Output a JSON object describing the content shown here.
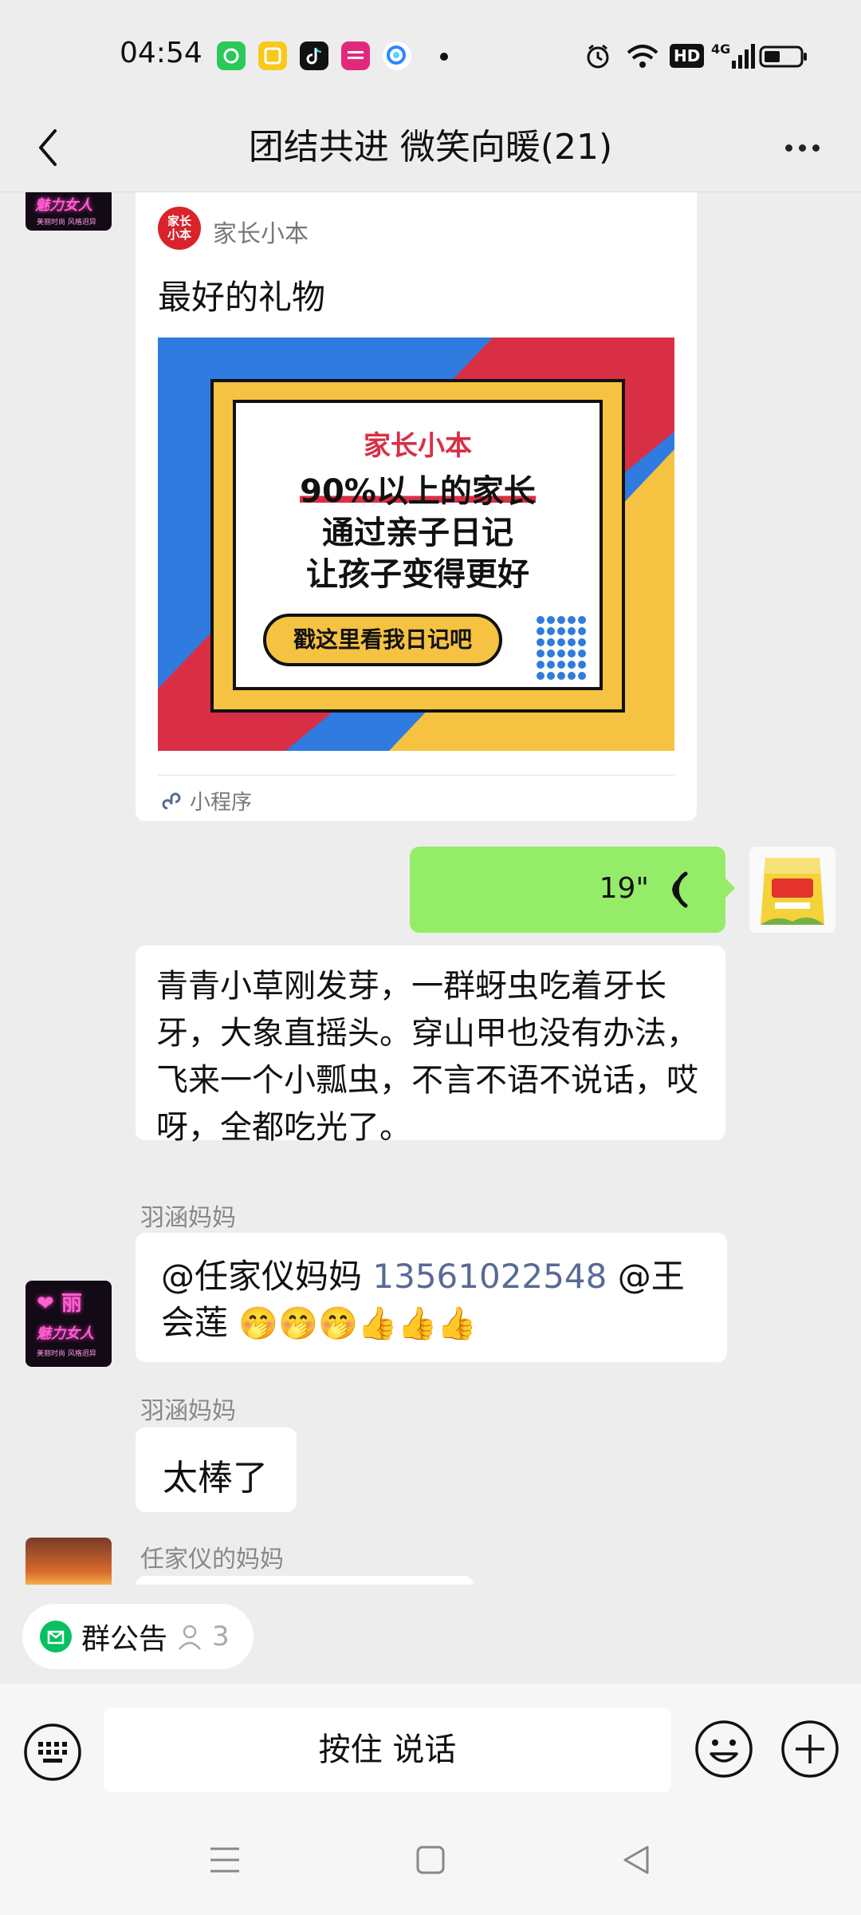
{
  "status_bar": {
    "time": "04:54",
    "icons_left": [
      "wechat-mini-icon",
      "yellow-app-icon",
      "tiktok-icon",
      "pink-app-icon",
      "browser-icon",
      "dot-icon"
    ],
    "icons_right": [
      "alarm-icon",
      "wifi-icon",
      "hd-icon",
      "4g-signal-icon",
      "battery-icon"
    ],
    "hd_label": "HD",
    "network_label": "4G",
    "battery_level": 0.45
  },
  "header": {
    "title": "团结共进  微笑向暖(21)"
  },
  "messages": {
    "card": {
      "source": "家长小本",
      "logo_text": "家长小本",
      "title": "最好的礼物",
      "banner": {
        "brand": "家长小本",
        "line1": "90%以上的家长",
        "line2": "通过亲子日记",
        "line3": "让孩子变得更好",
        "button": "戳这里看我日记吧"
      },
      "footer": "小程序"
    },
    "voice": {
      "duration": "19\""
    },
    "text_msg": "青青小草刚发芽，一群蚜虫吃着牙长牙，大象直摇头。穿山甲也没有办法，飞来一个小瓢虫，不言不语不说话，哎呀，全都吃光了。",
    "msg3": {
      "sender": "羽涵妈妈",
      "mention1": "@任家仪妈妈",
      "phone": "13561022548",
      "mention2": "@王会莲",
      "emoji": "🤭🤭🤭👍👍👍"
    },
    "msg4": {
      "sender": "羽涵妈妈",
      "text": "太棒了"
    },
    "msg5": {
      "sender": "任家仪的妈妈"
    },
    "avatar_text": {
      "top": "❤ 丽",
      "script": "魅力女人",
      "small": "美丽时尚 风格迥异"
    }
  },
  "notice": {
    "label": "群公告",
    "count": "3"
  },
  "input": {
    "hold_to_talk": "按住 说话"
  },
  "colors": {
    "background": "#ededed",
    "bubble_self": "#95ec69",
    "accent_green": "#07c160",
    "banner_blue": "#2f7be0",
    "banner_red": "#d92f45",
    "banner_yellow": "#f5c242",
    "phone_link": "#576b95"
  }
}
